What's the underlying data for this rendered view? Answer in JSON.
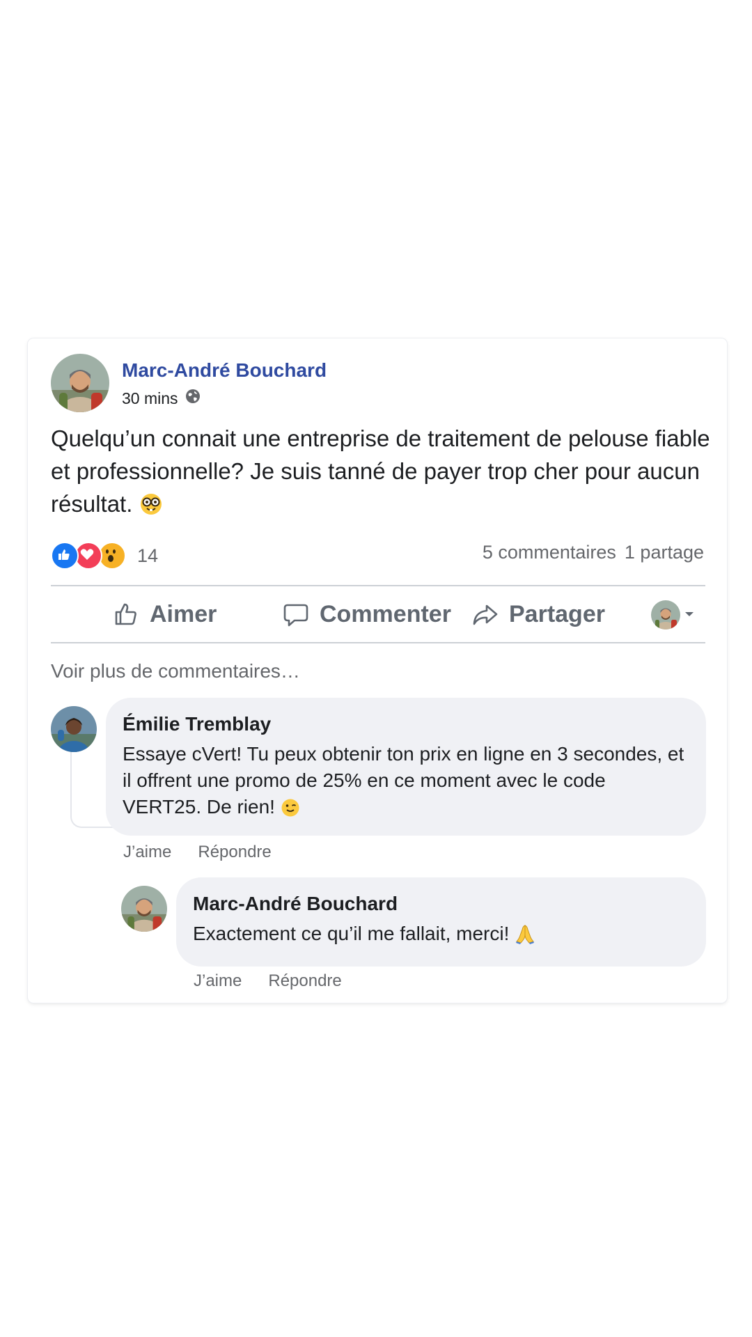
{
  "post": {
    "author": "Marc-André Bouchard",
    "time": "30 mins",
    "text": "Quelqu’un connait une entreprise de traitement de pelouse fiable et professionnelle? Je suis tanné de payer trop cher pour aucun résultat.",
    "text_emoji": "nerd-face-emoji"
  },
  "reactions": {
    "icons": [
      "like-icon",
      "love-icon",
      "wow-icon"
    ],
    "count": "14",
    "comments": "5 commentaires",
    "shares": "1 partage"
  },
  "actions": {
    "like": "Aimer",
    "comment": "Commenter",
    "share": "Partager"
  },
  "more_comments": "Voir plus de commentaires…",
  "comments": [
    {
      "name": "Émilie Tremblay",
      "text": "Essaye cVert! Tu peux obtenir ton prix en ligne en 3 secondes, et il offrent une promo de 25% en ce moment avec le code VERT25. De rien!",
      "emoji": "winking-face-emoji",
      "like": "J’aime",
      "reply": "Répondre"
    },
    {
      "name": "Marc-André Bouchard",
      "text": "Exactement ce qu’il me fallait, merci!",
      "emoji": "folded-hands-emoji",
      "like": "J’aime",
      "reply": "Répondre"
    }
  ],
  "colors": {
    "author_link": "#2f4aa0",
    "bubble": "#f0f1f5",
    "muted_text": "#65676b",
    "like_blue": "#1877f2",
    "love_red": "#f33e58",
    "wow_yellow": "#f7b125"
  }
}
